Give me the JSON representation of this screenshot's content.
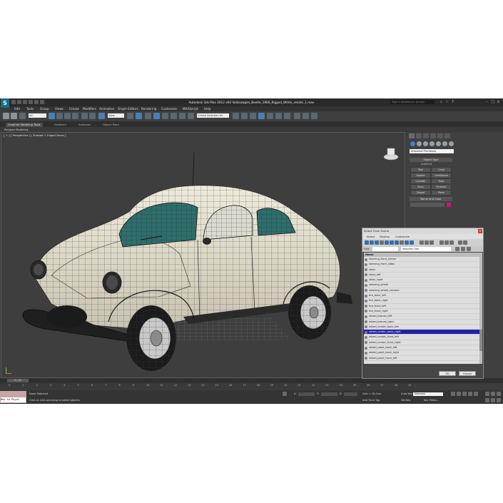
{
  "window": {
    "title": "Autodesk 3ds Max 2012 x64     Volkswagen_Beetle_1966_Rigged_White_render_1.max",
    "search_placeholder": "Type a keyword or phrase"
  },
  "menu": [
    "Edit",
    "Tools",
    "Group",
    "Views",
    "Create",
    "Modifiers",
    "Animation",
    "Graph Editors",
    "Rendering",
    "Customize",
    "MAXScript",
    "Help"
  ],
  "toolbar": {
    "filter_dropdown": "All",
    "view_dropdown": "View",
    "selection_set_dropdown": "Create Selection Se"
  },
  "ribbon": {
    "tabs": [
      "Graphite Modeling Tools",
      "Freeform",
      "Selection",
      "Object Paint"
    ],
    "active_tab": "Graphite Modeling Tools",
    "sub_label": "Polygon Modeling"
  },
  "viewport": {
    "label": "[ + ] [ Perspective ] [ Shaded + Edged Faces ]"
  },
  "command_panel": {
    "category_dropdown": "Standard Primitives",
    "object_type_rollout": "Object Type",
    "autogrid_label": "AutoGrid",
    "primitives": [
      "Box",
      "Cone",
      "Sphere",
      "GeoSphere",
      "Cylinder",
      "Tube",
      "Torus",
      "Pyramid",
      "Teapot",
      "Plane"
    ],
    "name_color_rollout": "Name and Color",
    "name_color_swatch": "#c2187a"
  },
  "select_dialog": {
    "title": "Select From Scene",
    "menu": [
      "Select",
      "Display",
      "Customize"
    ],
    "find_label": "Find:",
    "selection_set_label": "Selection Set:",
    "list_header": "Name",
    "items": [
      "steering_front_center",
      "steering_front_sides",
      "steer",
      "steer_left",
      "steer_right",
      "steering_wheel",
      "steering_wheel_chrome",
      "tire_back_left",
      "tire_back_right",
      "tire_front_left",
      "tire_front_right",
      "wheel_bronze_left",
      "wheel_bronze_right",
      "wheel_center_back_left",
      "wheel_center_back_right",
      "wheel_center_front_left",
      "wheel_center_front_right",
      "wheel_paint_back_left",
      "wheel_paint_back_right",
      "wheel_paint_front_left"
    ],
    "selected_item": "wheel_center_back_right",
    "ok_label": "OK",
    "cancel_label": "Cancel"
  },
  "timeline": {
    "slider_label": "0 / 29",
    "ticks": [
      "0",
      "1",
      "2",
      "3",
      "4",
      "5",
      "6",
      "7",
      "8",
      "9",
      "10",
      "11",
      "12",
      "13",
      "14",
      "15",
      "16",
      "17",
      "18",
      "19",
      "20",
      "21",
      "22",
      "23",
      "24",
      "25",
      "26",
      "27",
      "28",
      "29"
    ]
  },
  "status": {
    "selection_text": "None Selected",
    "prompt_text": "Click or click-and-drag to select objects",
    "maxscript_listener": "Max to Physc",
    "x_label": "X:",
    "y_label": "Y:",
    "z_label": "Z:",
    "grid_text": "Grid = 10,0cm",
    "add_time_tag": "Add Time Tag",
    "auto_key": "Auto Key",
    "set_key": "Set Key",
    "key_filters": "Key Filters...",
    "auto_key_dropdown": "Selected"
  }
}
